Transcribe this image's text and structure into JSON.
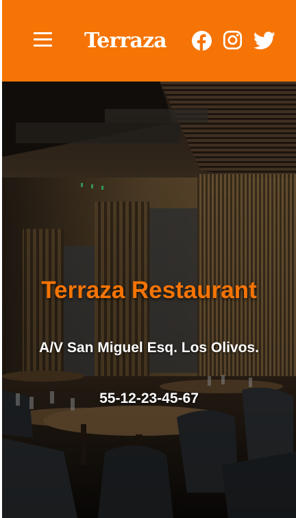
{
  "header": {
    "brand": "Terraza",
    "background_color": "#f57405",
    "menu_icon": "hamburger-menu-icon",
    "social": [
      {
        "name": "Facebook",
        "icon": "facebook-icon"
      },
      {
        "name": "Instagram",
        "icon": "instagram-icon"
      },
      {
        "name": "Twitter",
        "icon": "twitter-icon"
      }
    ]
  },
  "hero": {
    "title": "Terraza Restaurant",
    "title_color": "#f57405",
    "address": "A/V San Miguel Esq. Los Olivos.",
    "phone": "55-12-23-45-67",
    "background": "restaurant-interior-photo"
  }
}
